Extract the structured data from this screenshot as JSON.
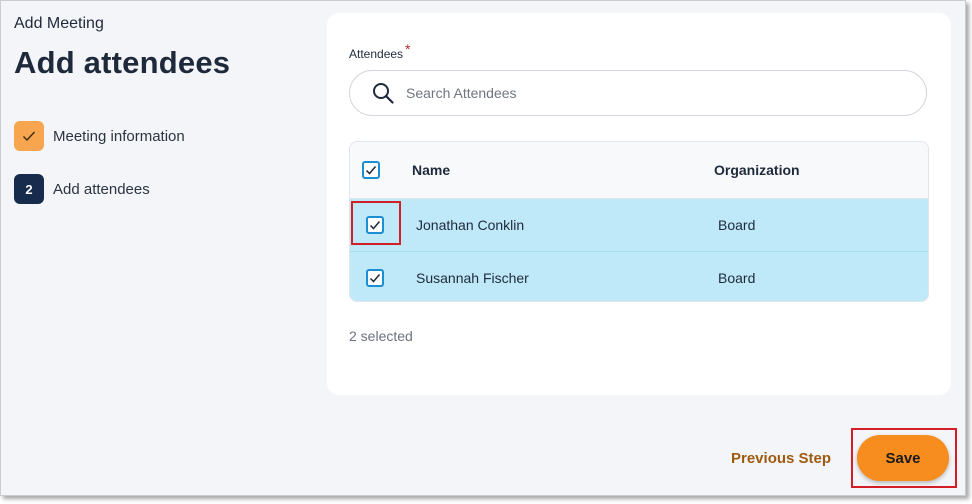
{
  "header": {
    "kicker": "Add Meeting",
    "title": "Add attendees"
  },
  "steps": [
    {
      "label": "Meeting information",
      "status": "complete",
      "badge": ""
    },
    {
      "label": "Add attendees",
      "status": "current",
      "badge": "2"
    }
  ],
  "attendees": {
    "label": "Attendees",
    "required_marker": "*",
    "search_placeholder": "Search Attendees",
    "columns": {
      "name": "Name",
      "organization": "Organization"
    },
    "rows": [
      {
        "name": "Jonathan Conklin",
        "organization": "Board",
        "checked": true
      },
      {
        "name": "Susannah Fischer",
        "organization": "Board",
        "checked": true
      }
    ],
    "selected_text": "2 selected"
  },
  "footer": {
    "previous_label": "Previous Step",
    "save_label": "Save"
  },
  "colors": {
    "accent_orange": "#f68d1e",
    "step_done": "#f7a54f",
    "step_current": "#172c4d",
    "row_selected": "#bfe9f8",
    "checkbox_blue": "#1a8fd3",
    "callout_red": "#d21f26"
  },
  "icons": {
    "search": "search-icon",
    "check": "check-icon"
  }
}
